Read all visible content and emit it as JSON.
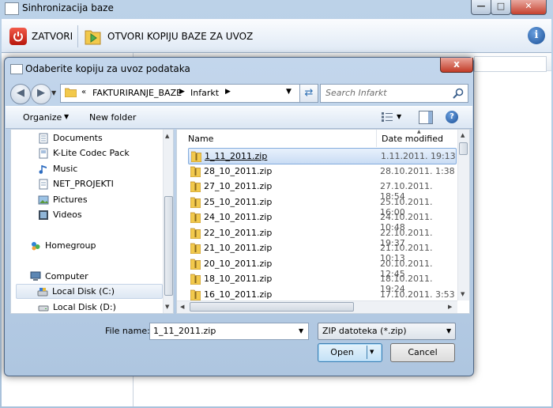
{
  "app": {
    "title": "Sinhronizacija baze",
    "toolbar": {
      "close_label": "ZATVORI",
      "open_label": "OTVORI KOPIJU BAZE ZA UVOZ"
    }
  },
  "dialog": {
    "title": "Odaberite kopiju za uvoz podataka",
    "close_symbol": "x",
    "address": {
      "prefix": "«",
      "crumbs": [
        "FAKTURIRANJE_BAZE",
        "Infarkt"
      ]
    },
    "search_placeholder": "Search Infarkt",
    "commands": {
      "organize": "Organize",
      "new_folder": "New folder"
    },
    "nav_items": [
      {
        "label": "Documents",
        "icon": "documents-icon"
      },
      {
        "label": "K-Lite Codec Pack",
        "icon": "folder-icon"
      },
      {
        "label": "Music",
        "icon": "music-icon"
      },
      {
        "label": "NET_PROJEKTI",
        "icon": "folder-icon"
      },
      {
        "label": "Pictures",
        "icon": "pictures-icon"
      },
      {
        "label": "Videos",
        "icon": "videos-icon"
      },
      {
        "label": "Homegroup",
        "icon": "homegroup-icon"
      },
      {
        "label": "Computer",
        "icon": "computer-icon"
      },
      {
        "label": "Local Disk (C:)",
        "icon": "disk-icon"
      },
      {
        "label": "Local Disk (D:)",
        "icon": "disk-icon"
      }
    ],
    "columns": {
      "name": "Name",
      "date": "Date modified"
    },
    "files": [
      {
        "name": "1_11_2011.zip",
        "date": "1.11.2011. 19:13"
      },
      {
        "name": "28_10_2011.zip",
        "date": "28.10.2011. 1:38"
      },
      {
        "name": "27_10_2011.zip",
        "date": "27.10.2011. 18:54"
      },
      {
        "name": "25_10_2011.zip",
        "date": "25.10.2011. 16:00"
      },
      {
        "name": "24_10_2011.zip",
        "date": "24.10.2011. 10:48"
      },
      {
        "name": "22_10_2011.zip",
        "date": "22.10.2011. 19:37"
      },
      {
        "name": "21_10_2011.zip",
        "date": "21.10.2011. 10:13"
      },
      {
        "name": "20_10_2011.zip",
        "date": "20.10.2011. 12:45"
      },
      {
        "name": "18_10_2011.zip",
        "date": "18.10.2011. 19:24"
      },
      {
        "name": "16_10_2011.zip",
        "date": "17.10.2011. 3:53"
      }
    ],
    "file_name_label": "File name:",
    "file_name_value": "1_11_2011.zip",
    "file_type_value": "ZIP datoteka  (*.zip)",
    "open_label": "Open",
    "cancel_label": "Cancel"
  }
}
